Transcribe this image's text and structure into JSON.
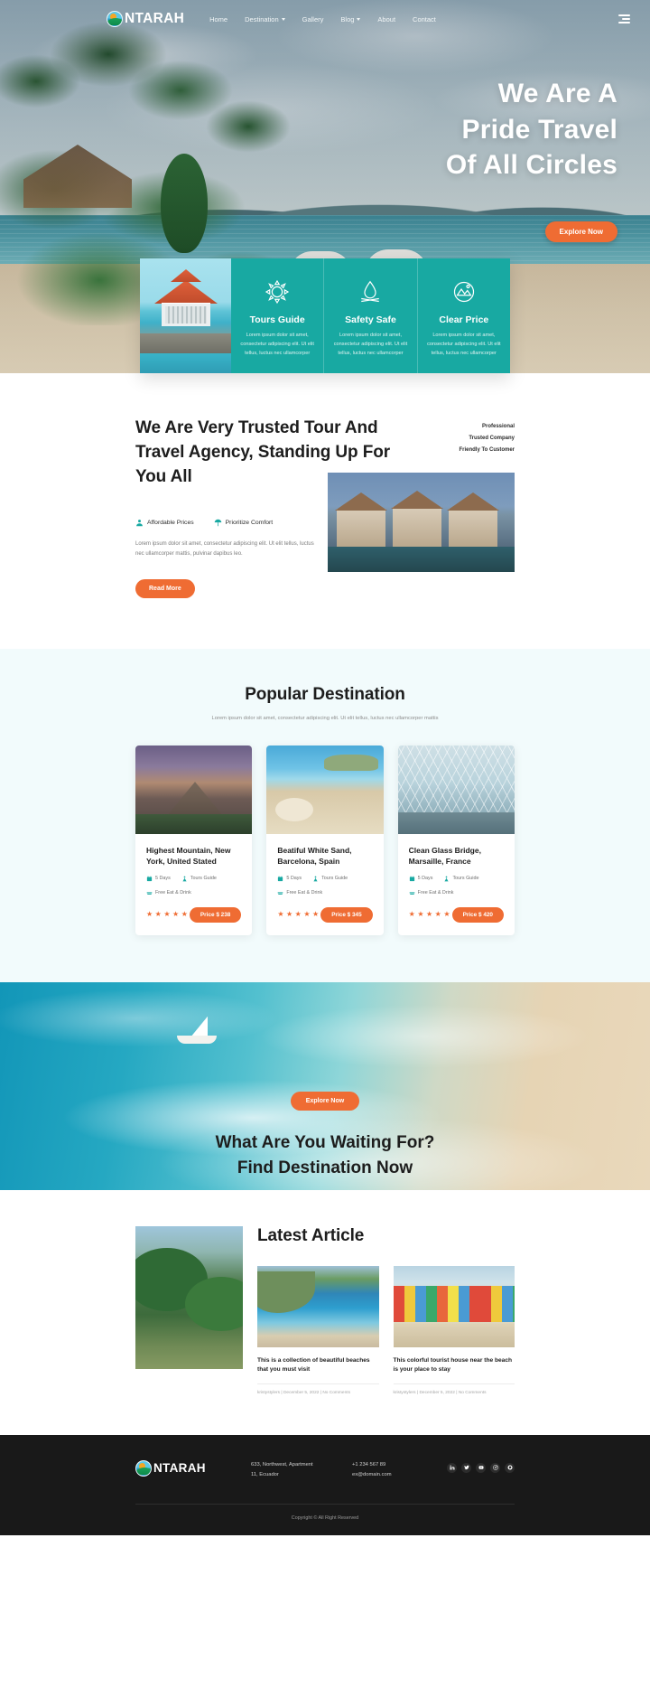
{
  "brand": {
    "name": "NTARAH",
    "logo_icon": "sun-wave-circle-logo"
  },
  "nav": {
    "items": [
      {
        "label": "Home",
        "has_dropdown": false
      },
      {
        "label": "Destination",
        "has_dropdown": true
      },
      {
        "label": "Gallery",
        "has_dropdown": false
      },
      {
        "label": "Blog",
        "has_dropdown": true
      },
      {
        "label": "About",
        "has_dropdown": false
      },
      {
        "label": "Contact",
        "has_dropdown": false
      }
    ],
    "menu_icon": "hamburger-icon"
  },
  "hero": {
    "title_line1": "We Are A",
    "title_line2": "Pride Travel",
    "title_line3": "Of All Circles",
    "cta_label": "Explore Now"
  },
  "features": {
    "image_alt": "beach-gazebo-photo",
    "cards": [
      {
        "icon": "sun-icon",
        "title": "Tours Guide",
        "desc": "Lorem ipsum dolor sit amet, consectetur adipiscing elit. Ut elit tellus, luctus nec ullamcorper"
      },
      {
        "icon": "campfire-icon",
        "title": "Safety Safe",
        "desc": "Lorem ipsum dolor sit amet, consectetur adipiscing elit. Ut elit tellus, luctus nec ullamcorper"
      },
      {
        "icon": "mountain-badge-icon",
        "title": "Clear Price",
        "desc": "Lorem ipsum dolor sit amet, consectetur adipiscing elit. Ut elit tellus, luctus nec ullamcorper"
      }
    ]
  },
  "about": {
    "title": "We Are Very Trusted Tour And Travel Agency, Standing Up For You All",
    "badges": [
      "Professional",
      "Trusted Company",
      "Friendly To Customer"
    ],
    "pills": [
      {
        "icon": "price-tag-icon",
        "label": "Affordable Prices"
      },
      {
        "icon": "umbrella-icon",
        "label": "Prioritize Comfort"
      }
    ],
    "paragraph": "Lorem ipsum dolor sit amet, consectetur adipiscing elit. Ut elit tellus, luctus nec ullamcorper mattis, pulvinar dapibus leo.",
    "cta_label": "Read More",
    "image_alt": "village-houses-photo"
  },
  "popular": {
    "title": "Popular Destination",
    "subtitle": "Lorem ipsum dolor sit amet, consectetur adipiscing elit. Ut elit tellus, luctus nec ullamcorper mattis",
    "cards": [
      {
        "image": "volcano-mountain-photo",
        "title": "Highest Mountain, New York, United Stated",
        "duration": "5 Days",
        "guide": "Tours Guide",
        "perk": "Free Eat & Drink",
        "rating": 5,
        "price_label": "Price $ 238"
      },
      {
        "image": "white-sand-beach-photo",
        "title": "Beatiful White Sand, Barcelona, Spain",
        "duration": "5 Days",
        "guide": "Tours Guide",
        "perk": "Free Eat & Drink",
        "rating": 5,
        "price_label": "Price $ 345"
      },
      {
        "image": "glass-bridge-photo",
        "title": "Clean Glass Bridge, Marsaille, France",
        "duration": "5 Days",
        "guide": "Tours Guide",
        "perk": "Free Eat & Drink",
        "rating": 5,
        "price_label": "Price $ 420"
      }
    ]
  },
  "cta_banner": {
    "button_label": "Explore Now",
    "title_line1": "What Are You Waiting For?",
    "title_line2": "Find Destination Now",
    "image_alt": "aerial-ocean-sailboat-photo"
  },
  "articles": {
    "title": "Latest Article",
    "hero_image_alt": "tropical-garden-photo",
    "items": [
      {
        "image": "beach-cove-photo",
        "caption": "This is a collection of beautiful beaches that you must visit",
        "meta": "kristystylers | December 5, 2022 | No Comments"
      },
      {
        "image": "colorful-beach-huts-photo",
        "caption": "This colorful tourist house near the beach is your place to stay",
        "meta": "kristystylers | December 5, 2022 | No Comments"
      }
    ]
  },
  "footer": {
    "brand": "NTARAH",
    "address_line1": "633, Northwest, Apartment",
    "address_line2": "11, Ecuador",
    "phone": "+1 234 567 89",
    "email": "ex@domain.com",
    "social": [
      "linkedin-icon",
      "twitter-icon",
      "youtube-icon",
      "instagram-icon",
      "pinterest-icon"
    ],
    "copyright": "Copyright © All Right Reserved"
  }
}
